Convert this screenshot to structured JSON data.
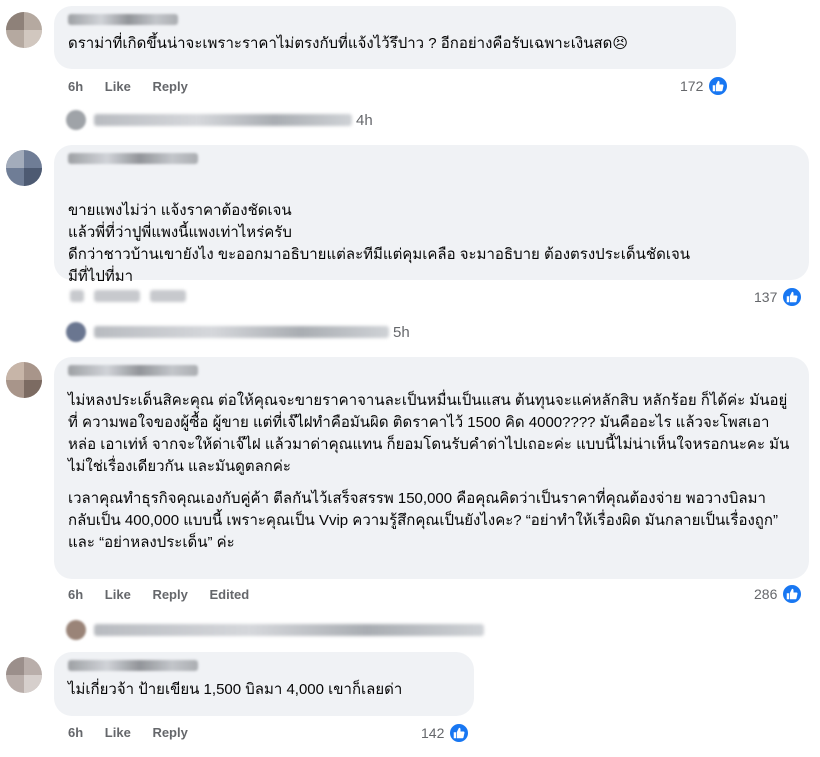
{
  "comments": [
    {
      "text": [
        "ดราม่าที่เกิดขึ้นน่าจะเพราะราคาไม่ตรงกับที่แจ้งไว้รึปาว ? อีกอย่างคือรับเฉพาะเงินสด😣"
      ],
      "time": "6h",
      "like": "Like",
      "reply": "Reply",
      "likes": "172"
    },
    {
      "text": [
        "ขายแพงไม่ว่า แจ้งราคาต้องชัดเจน\nแล้วพี่ที่ว่าปูพี่แพงนี้แพงเท่าไหร่ครับ\nดีกว่าชาวบ้านเขายังไง ขะออกมาอธิบายแต่ละทีมีแต่คุมเคลือ จะมาอธิบาย ต้องตรงประเด็นชัดเจน\nมีที่ไปที่มา"
      ],
      "likes": "137"
    },
    {
      "text": [
        "ไม่หลงประเด็นสิคะคุณ ต่อให้คุณจะขายราคาจานละเป็นหมื่นเป็นแสน ต้นทุนจะแค่หลักสิบ หลักร้อย ก็ได้ค่ะ มันอยู่ที่ ความพอใจของผู้ซื้อ ผู้ขาย แต่ที่เจ๊ไฝทำคือมันผิด ติดราคาไว้ 1500 คิด 4000???? มันคืออะไร แล้วจะโพสเอาหล่อ เอาเท่ห์ จากจะให้ด่าเจ๊ไฝ แล้วมาด่าคุณแทน ก็ยอมโดนรับคำด่าไปเถอะค่ะ แบบนี้ไม่น่าเห็นใจหรอกนะคะ มันไม่ใช่เรื่องเดียวกัน และมันดูตลกค่ะ",
        "เวลาคุณทำธุรกิจคุณเองกับคู่ค้า ตีลกันไว้เสร็จสรรพ 150,000 คือคุณคิดว่าเป็นราคาที่คุณต้องจ่าย พอวางบิลมา กลับเป็น 400,000 แบบนี้ เพราะคุณเป็น Vvip ความรู้สึกคุณเป็นยังไงคะ? “อย่าทำให้เรื่องผิด มันกลายเป็นเรื่องถูก” และ “อย่าหลงประเด็น” ค่ะ"
      ],
      "time": "6h",
      "like": "Like",
      "reply": "Reply",
      "edited": "Edited",
      "likes": "286"
    },
    {
      "text": [
        "ไม่เกี่ยวจ้า ป้ายเขียน 1,500 บิลมา 4,000 เขาก็เลยด่า"
      ],
      "time": "6h",
      "like": "Like",
      "reply": "Reply",
      "likes": "142"
    }
  ],
  "reply_rows": [
    {
      "time": "4h"
    },
    {
      "time": "5h"
    }
  ],
  "colors": {
    "like_blue": "#1877f2",
    "bubble": "#f0f2f5",
    "meta_gray": "#65676b"
  },
  "icons": [
    "like-thumb-icon"
  ]
}
